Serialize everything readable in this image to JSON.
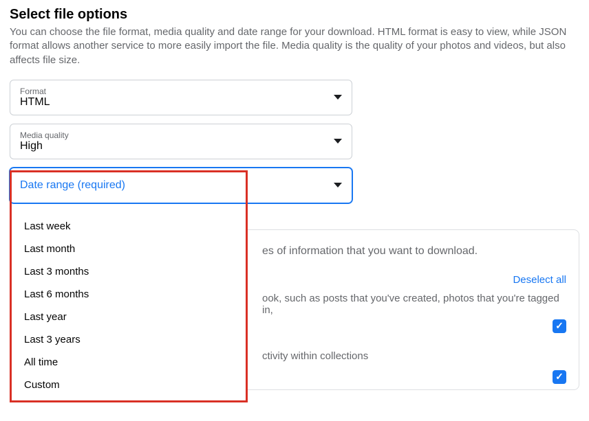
{
  "section": {
    "title": "Select file options",
    "description": "You can choose the file format, media quality and date range for your download. HTML format is easy to view, while JSON format allows another service to more easily import the file. Media quality is the quality of your photos and videos, but also affects file size."
  },
  "selects": {
    "format": {
      "label": "Format",
      "value": "HTML"
    },
    "media_quality": {
      "label": "Media quality",
      "value": "High"
    },
    "date_range": {
      "placeholder": "Date range (required)"
    }
  },
  "dropdown_options": [
    "Last week",
    "Last month",
    "Last 3 months",
    "Last 6 months",
    "Last year",
    "Last 3 years",
    "All time",
    "Custom"
  ],
  "lower": {
    "desc_fragment": "es of information that you want to download.",
    "deselect": "Deselect all",
    "tagged_fragment": "ook, such as posts that you've created, photos that you're tagged in,",
    "activity_fragment": "ctivity within collections"
  },
  "checkmark": "✓"
}
